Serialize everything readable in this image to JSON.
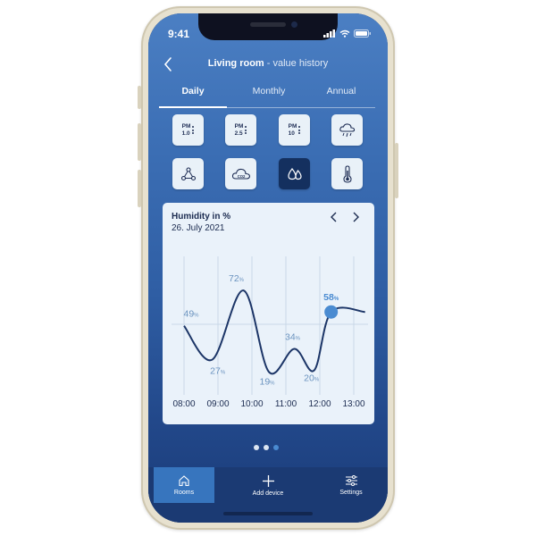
{
  "status": {
    "time": "9:41"
  },
  "header": {
    "room": "Living room",
    "subtitle": " - value history"
  },
  "tabs": [
    {
      "label": "Daily",
      "active": true
    },
    {
      "label": "Monthly",
      "active": false
    },
    {
      "label": "Annual",
      "active": false
    }
  ],
  "sensors": [
    {
      "label": "PM 1.0",
      "line1": "PM",
      "line2": "1.0",
      "icon": "pm1-icon",
      "selected": false
    },
    {
      "label": "PM 2.5",
      "line1": "PM",
      "line2": "2.5",
      "icon": "pm25-icon",
      "selected": false
    },
    {
      "label": "PM 10",
      "line1": "PM",
      "line2": "10",
      "icon": "pm10-icon",
      "selected": false
    },
    {
      "label": "weather",
      "icon": "cloud-rain-icon",
      "selected": false
    },
    {
      "label": "molecule",
      "icon": "molecule-icon",
      "selected": false
    },
    {
      "label": "CO2",
      "co2": "CO2",
      "icon": "co2-cloud-icon",
      "selected": false
    },
    {
      "label": "humidity",
      "icon": "humidity-drops-icon",
      "selected": true
    },
    {
      "label": "temperature",
      "icon": "thermometer-icon",
      "selected": false
    }
  ],
  "card": {
    "title": "Humidity in %",
    "date": "26. July 2021"
  },
  "chart_data": {
    "type": "line",
    "x": [
      "08:00",
      "09:00",
      "10:00",
      "11:00",
      "12:00",
      "13:00"
    ],
    "points": [
      {
        "x": "08:00",
        "y": 49
      },
      {
        "x": "08:50",
        "y": 27
      },
      {
        "x": "09:45",
        "y": 72
      },
      {
        "x": "10:30",
        "y": 19
      },
      {
        "x": "11:15",
        "y": 34
      },
      {
        "x": "11:50",
        "y": 20
      },
      {
        "x": "12:20",
        "y": 58
      },
      {
        "x": "13:20",
        "y": 58
      }
    ],
    "labels": [
      {
        "x": "08:00",
        "value": "49",
        "unit": "%"
      },
      {
        "x": "08:50",
        "value": "27",
        "unit": "%"
      },
      {
        "x": "09:45",
        "value": "72",
        "unit": "%"
      },
      {
        "x": "10:30",
        "value": "19",
        "unit": "%"
      },
      {
        "x": "11:15",
        "value": "34",
        "unit": "%"
      },
      {
        "x": "11:50",
        "value": "20",
        "unit": "%"
      },
      {
        "x": "12:20",
        "value": "58",
        "unit": "%",
        "highlight": true
      }
    ],
    "ylim": [
      0,
      100
    ],
    "grid": true
  },
  "pagination": {
    "count": 3,
    "active": 2
  },
  "bottom_nav": [
    {
      "label": "Rooms",
      "icon": "home-icon",
      "active": true
    },
    {
      "label": "Add device",
      "icon": "plus-icon",
      "active": false
    },
    {
      "label": "Settings",
      "icon": "sliders-icon",
      "active": false
    }
  ],
  "colors": {
    "line": "#1c3567",
    "highlight": "#4a8bd1",
    "label": "#6b93bf",
    "accent": "#3775be"
  }
}
